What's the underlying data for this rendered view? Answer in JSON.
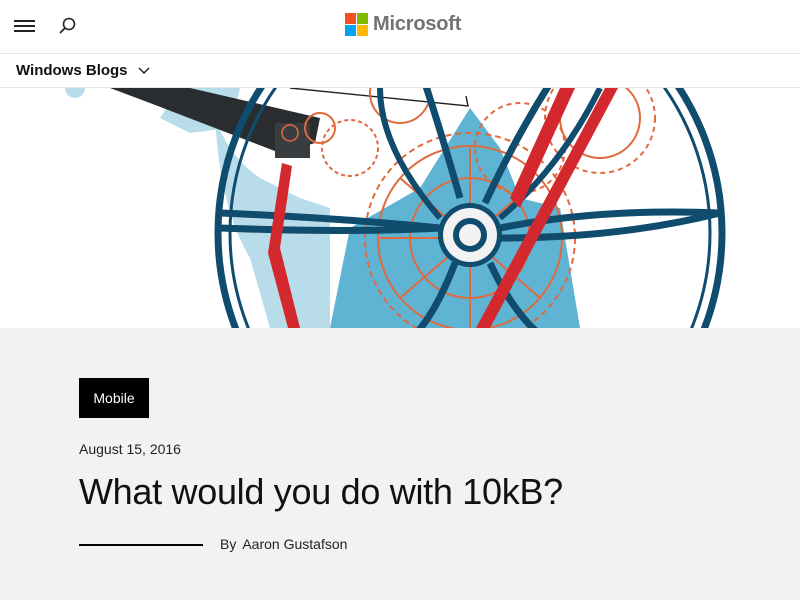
{
  "header": {
    "menu_icon": "hamburger-icon",
    "search_icon": "search-icon",
    "brand": "Microsoft",
    "brand_colors": [
      "#f25022",
      "#7fba00",
      "#00a4ef",
      "#ffb900"
    ]
  },
  "subnav": {
    "label": "Windows Blogs",
    "icon": "chevron-down-icon"
  },
  "hero": {
    "description_icon": "bicycle-gear-illustration",
    "colors": {
      "navy": "#0f4c6e",
      "lightblue": "#5fb3d3",
      "orange": "#e06a3e",
      "red": "#d3282d"
    }
  },
  "article": {
    "category": "Mobile",
    "date": "August 15, 2016",
    "title": "What would you do with 10kB?",
    "byline_prefix": "By",
    "author": "Aaron Gustafson"
  }
}
